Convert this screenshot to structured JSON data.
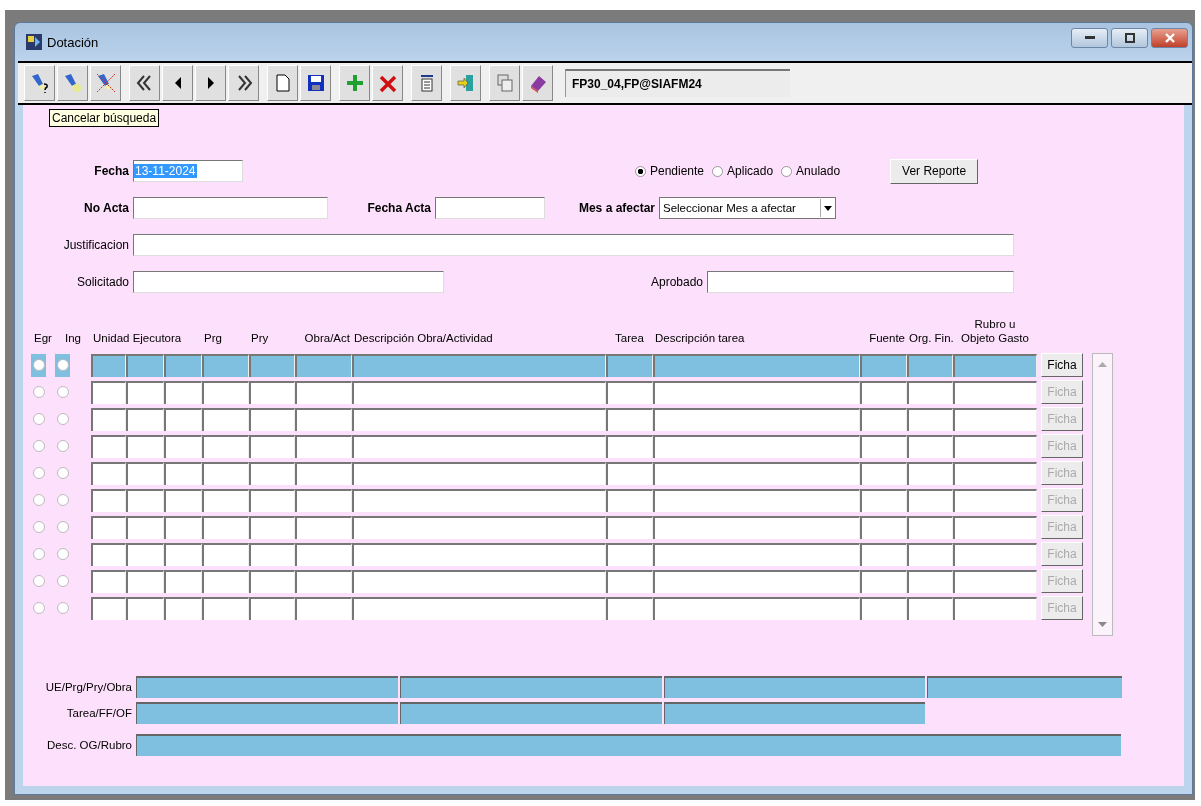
{
  "window": {
    "title": "Dotación"
  },
  "toolbar": {
    "connection": "FP30_04,FP@SIAFM24"
  },
  "tooltip": "Cancelar búsqueda",
  "form": {
    "fecha": {
      "label": "Fecha",
      "value": "13-11-2024",
      "highlighted": true
    },
    "no_acta": {
      "label": "No Acta"
    },
    "fecha_acta": {
      "label": "Fecha Acta"
    },
    "mes": {
      "label": "Mes a afectar",
      "value": "Seleccionar Mes a afectar"
    },
    "justificacion": {
      "label": "Justificacion"
    },
    "solicitado": {
      "label": "Solicitado"
    },
    "aprobado": {
      "label": "Aprobado"
    },
    "status": [
      {
        "label": "Pendiente",
        "selected": true
      },
      {
        "label": "Aplicado",
        "selected": false
      },
      {
        "label": "Anulado",
        "selected": false
      }
    ],
    "report_button": "Ver Reporte"
  },
  "grid": {
    "headers": [
      "Egr",
      "Ing",
      "Unidad Ejecutora",
      "Prg",
      "Pry",
      "Obra/Act",
      "Descripción Obra/Actividad",
      "Tarea",
      "Descripción tarea",
      "Fuente",
      "Org. Fin.",
      "Rubro u\nObjeto Gasto"
    ],
    "rows": [
      {
        "selected": true,
        "egr": false,
        "ing": false,
        "ficha": {
          "label": "Ficha",
          "disabled": false
        }
      },
      {
        "selected": false,
        "egr": false,
        "ing": false,
        "ficha": {
          "label": "Ficha",
          "disabled": true
        }
      },
      {
        "selected": false,
        "egr": false,
        "ing": false,
        "ficha": {
          "label": "Ficha",
          "disabled": true
        }
      },
      {
        "selected": false,
        "egr": false,
        "ing": false,
        "ficha": {
          "label": "Ficha",
          "disabled": true
        }
      },
      {
        "selected": false,
        "egr": false,
        "ing": false,
        "ficha": {
          "label": "Ficha",
          "disabled": true
        }
      },
      {
        "selected": false,
        "egr": false,
        "ing": false,
        "ficha": {
          "label": "Ficha",
          "disabled": true
        }
      },
      {
        "selected": false,
        "egr": false,
        "ing": false,
        "ficha": {
          "label": "Ficha",
          "disabled": true
        }
      },
      {
        "selected": false,
        "egr": false,
        "ing": false,
        "ficha": {
          "label": "Ficha",
          "disabled": true
        }
      },
      {
        "selected": false,
        "egr": false,
        "ing": false,
        "ficha": {
          "label": "Ficha",
          "disabled": true
        }
      },
      {
        "selected": false,
        "egr": false,
        "ing": false,
        "ficha": {
          "label": "Ficha",
          "disabled": true
        }
      }
    ]
  },
  "summary": [
    {
      "label": "UE/Prg/Pry/Obra",
      "kind": "quad"
    },
    {
      "label": "Tarea/FF/OF",
      "kind": "triple"
    },
    {
      "label": "Desc. OG/Rubro",
      "kind": "wide"
    }
  ]
}
